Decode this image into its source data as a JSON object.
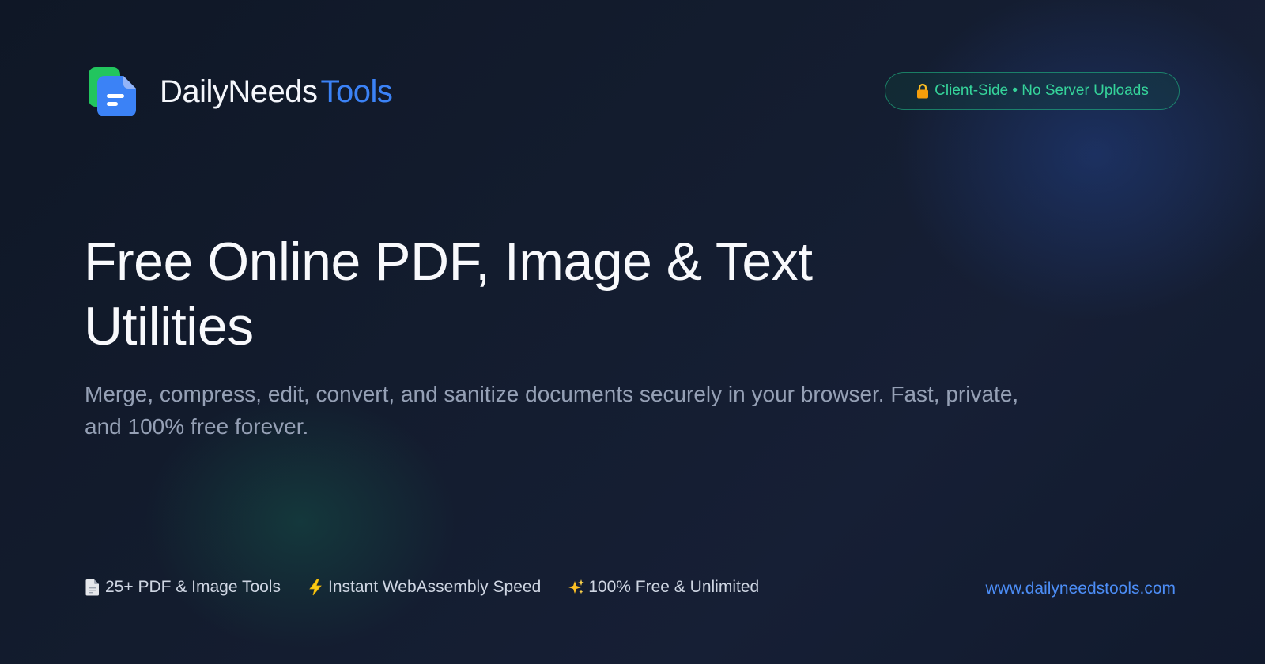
{
  "brand": {
    "name_part1": "DailyNeeds",
    "name_part2": "Tools",
    "logo_icon": "document-stack-icon"
  },
  "badge": {
    "icon": "lock-icon",
    "text": "Client-Side • No Server Uploads"
  },
  "hero": {
    "title": "Free Online PDF, Image & Text Utilities",
    "subtitle": "Merge, compress, edit, convert, and sanitize documents securely in your browser. Fast, private, and 100% free forever."
  },
  "features": [
    {
      "icon": "document-icon",
      "label": "25+ PDF & Image Tools"
    },
    {
      "icon": "lightning-icon",
      "label": "Instant WebAssembly Speed"
    },
    {
      "icon": "sparkles-icon",
      "label": "100% Free & Unlimited"
    }
  ],
  "footer": {
    "url": "www.dailyneedstools.com"
  },
  "colors": {
    "brand_blue": "#3b82f6",
    "brand_green": "#22c55e",
    "badge_green": "#35d39a",
    "background": "#131c2e",
    "lock_orange": "#f59e0b",
    "lightning_yellow": "#facc15"
  }
}
